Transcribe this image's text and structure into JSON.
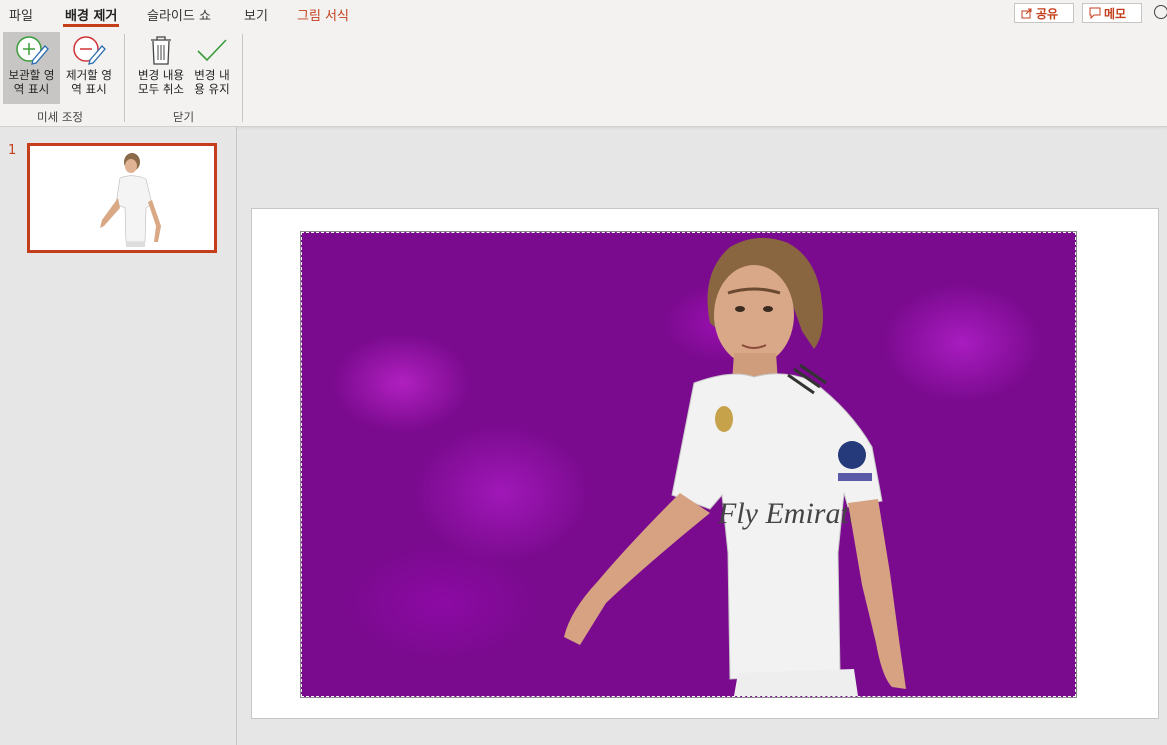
{
  "tabs": {
    "file": "파일",
    "background_removal": "배경 제거",
    "slideshow": "슬라이드 쇼",
    "view": "보기",
    "picture_format": "그림 서식"
  },
  "top_actions": {
    "share": "공유",
    "comments": "메모"
  },
  "ribbon": {
    "mark_keep": "보관할 영\n역 표시",
    "mark_remove": "제거할 영\n역 표시",
    "discard_all": "변경 내용\n모두 취소",
    "keep_changes": "변경 내\n용 유지",
    "group_refine": "미세 조정",
    "group_close": "닫기"
  },
  "slides": {
    "number": "1"
  },
  "photo_jersey_text": "Fly Emirates",
  "colors": {
    "accent": "#c43e1c",
    "removal_overlay": "#7a0a8e"
  }
}
